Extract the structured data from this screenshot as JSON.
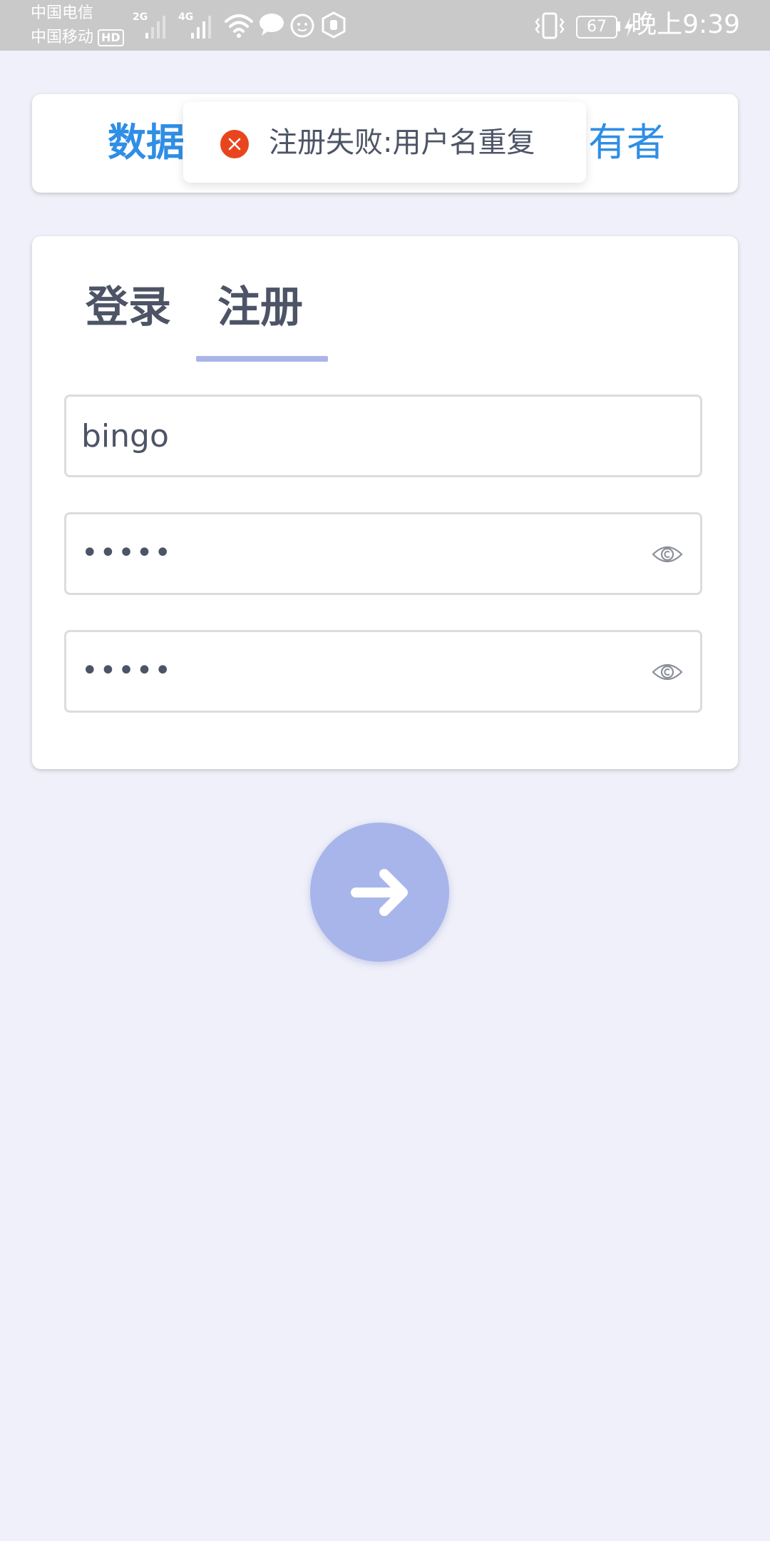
{
  "status_bar": {
    "carrier_1": "中国电信",
    "carrier_2": "中国移动",
    "hd_badge": "HD",
    "signal_1_tag": "2G",
    "signal_2_tag": "4G",
    "battery_level": "67",
    "time": "晚上9:39",
    "icons": [
      "wifi-icon",
      "chat-bubble-icon",
      "app-face-icon",
      "hand-shield-icon",
      "vibrate-icon",
      "charging-icon"
    ]
  },
  "header": {
    "title_left": "数据",
    "title_right": "有者"
  },
  "toast": {
    "icon": "error-x-icon",
    "color": "#e8451e",
    "message": "注册失败:用户名重复"
  },
  "auth_tabs": {
    "login_label": "登录",
    "register_label": "注册",
    "active": "register",
    "underline_color": "#abb4e8"
  },
  "form": {
    "username_value": "bingo",
    "password_value": "•••••",
    "confirm_password_value": "•••••",
    "password_toggle_icon": "eye-icon"
  },
  "submit": {
    "icon": "arrow-right-icon",
    "color": "#a8b5ea"
  },
  "colors": {
    "background": "#eff0f9",
    "accent_blue": "#2f8ee5",
    "text_dark": "#4d5466"
  }
}
